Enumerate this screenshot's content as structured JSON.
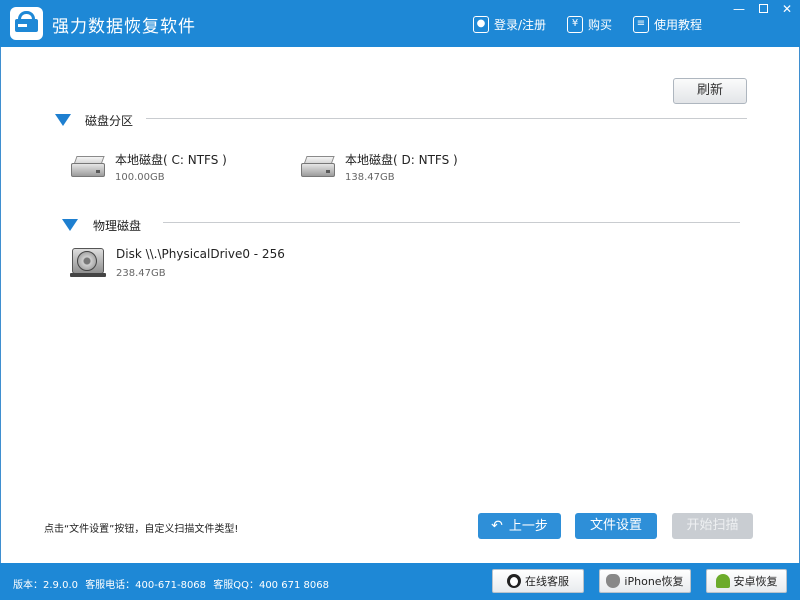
{
  "app": {
    "title": "强力数据恢复软件"
  },
  "top_menu": {
    "login": "登录/注册",
    "buy": "购买",
    "tutorial": "使用教程",
    "buy_icon_glyph": "¥"
  },
  "window_controls": {
    "minimize": "—",
    "close": "✕"
  },
  "toolbar": {
    "refresh_label": "刷新"
  },
  "sections": {
    "partitions": {
      "label": "磁盘分区",
      "drives": [
        {
          "name": "本地磁盘( C: NTFS )",
          "size": "100.00GB",
          "icon": "hard-drive-icon"
        },
        {
          "name": "本地磁盘( D: NTFS )",
          "size": "138.47GB",
          "icon": "hard-drive-icon"
        }
      ]
    },
    "physical": {
      "label": "物理磁盘",
      "disks": [
        {
          "name": "Disk \\\\.\\PhysicalDrive0 - 256",
          "size": "238.47GB",
          "icon": "physical-disk-icon"
        }
      ]
    }
  },
  "hint": "点击“文件设置”按钮，自定义扫描文件类型!",
  "actions": {
    "prev": "上一步",
    "file_settings": "文件设置",
    "start_scan": "开始扫描",
    "start_scan_enabled": false
  },
  "footer": {
    "version": "版本：2.9.0.0",
    "phone": "客服电话：400-671-8068",
    "qq": "客服QQ：400 671 8068",
    "buttons": {
      "online_service": "在线客服",
      "iphone_recovery": "iPhone恢复",
      "android_recovery": "安卓恢复"
    }
  },
  "colors": {
    "brand_blue": "#1e88d6",
    "button_blue": "#2e8fd8",
    "disabled_gray": "#c9cdd2"
  }
}
